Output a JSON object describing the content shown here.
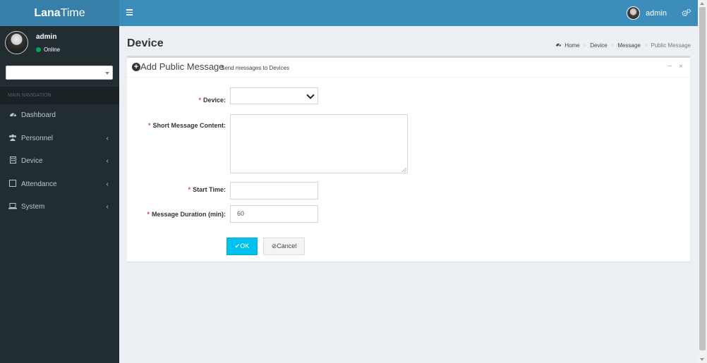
{
  "app": {
    "logo_bold": "Lana",
    "logo_light": "Time"
  },
  "header": {
    "user_name": "admin"
  },
  "sidebar": {
    "user": {
      "name": "admin",
      "status": "Online"
    },
    "search_value": "",
    "nav_header": "MAIN NAVIGATION",
    "items": [
      {
        "label": "Dashboard",
        "icon": "dashboard-icon",
        "has_children": false
      },
      {
        "label": "Personnel",
        "icon": "users-icon",
        "has_children": true
      },
      {
        "label": "Device",
        "icon": "device-icon",
        "has_children": true
      },
      {
        "label": "Attendance",
        "icon": "calendar-icon",
        "has_children": true
      },
      {
        "label": "System",
        "icon": "laptop-icon",
        "has_children": true
      }
    ]
  },
  "page": {
    "title": "Device",
    "breadcrumb": [
      "Home",
      "Device",
      "Message",
      "Public Message"
    ]
  },
  "form": {
    "title": "Add Public Message",
    "subtitle": "Send messages to Devices",
    "fields": {
      "device": {
        "label": "Device:",
        "value": ""
      },
      "content": {
        "label": "Short Message Content:",
        "value": ""
      },
      "start_time": {
        "label": "Start Time:",
        "value": ""
      },
      "duration": {
        "label": "Message Duration (min):",
        "value": "60"
      }
    },
    "ok_label": "OK",
    "cancel_label": "Cancel"
  },
  "colors": {
    "header": "#3c8dbc",
    "logo": "#367fa9",
    "sidebar": "#222d32",
    "primary_button": "#00c0ef",
    "required": "#dd4b39",
    "online": "#00a65a"
  }
}
